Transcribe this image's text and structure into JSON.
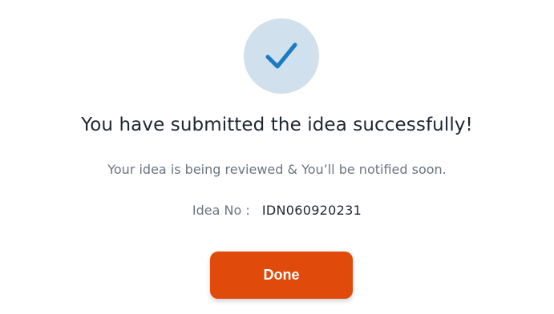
{
  "icon": {
    "name": "checkmark-icon",
    "circle_color": "#d0e0ec",
    "check_color": "#1a7bc4"
  },
  "dialog": {
    "title": "You have submitted the idea successfully!",
    "subtitle": "Your idea is being reviewed & You’ll be notified soon.",
    "idea_label": "Idea No :",
    "idea_number": "IDN060920231",
    "done_label": "Done"
  },
  "colors": {
    "accent": "#e04a0a"
  }
}
